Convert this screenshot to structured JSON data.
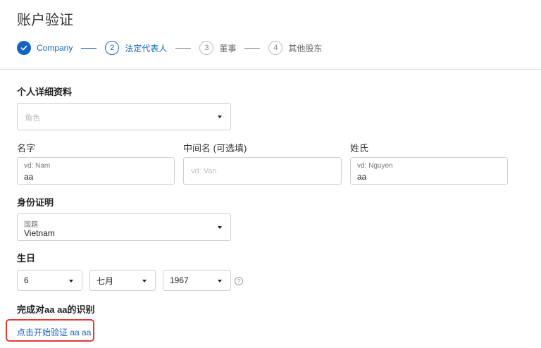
{
  "page": {
    "title": "账户验证"
  },
  "stepper": {
    "steps": [
      {
        "number": "",
        "label": "Company",
        "state": "done"
      },
      {
        "number": "2",
        "label": "法定代表人",
        "state": "active"
      },
      {
        "number": "3",
        "label": "董事",
        "state": "pending"
      },
      {
        "number": "4",
        "label": "其他股东",
        "state": "pending"
      }
    ]
  },
  "personal": {
    "heading": "个人详细资料",
    "role": {
      "placeholder": "角色"
    },
    "first_name": {
      "label": "名字",
      "hint": "vd: Nam",
      "value": "aa"
    },
    "middle_name": {
      "label": "中间名 (可选填)",
      "placeholder": "vd: Van"
    },
    "last_name": {
      "label": "姓氏",
      "hint": "vd: Nguyen",
      "value": "aa"
    }
  },
  "identity": {
    "heading": "身份证明",
    "nationality": {
      "label": "国籍",
      "value": "Vietnam"
    }
  },
  "birth": {
    "heading": "生日",
    "day": "6",
    "month": "七月",
    "year": "1967",
    "help_icon": "question-circle-icon"
  },
  "verification": {
    "heading": "完成对aa aa的识别",
    "link": "点击开始验证 aa aa"
  },
  "colors": {
    "accent": "#1565c0",
    "highlight": "#e53935"
  }
}
